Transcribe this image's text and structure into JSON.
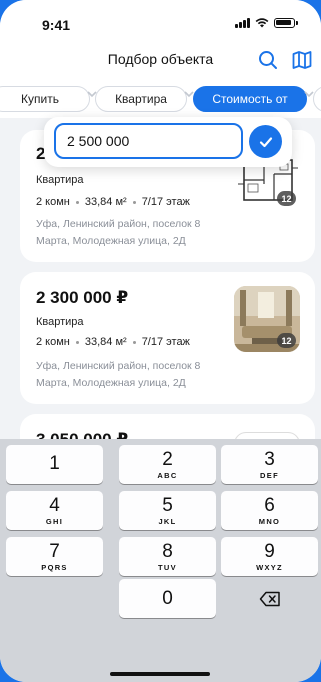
{
  "status": {
    "time": "9:41"
  },
  "header": {
    "title": "Подбор объекта",
    "search_icon": "search-icon",
    "map_icon": "map-icon"
  },
  "filters": [
    "Купить",
    "Квартира",
    "Стоимость от",
    ""
  ],
  "price_popover": {
    "value": "2 500 000",
    "confirm_icon": "checkmark-icon"
  },
  "listings": [
    {
      "price": "2",
      "type": "Квартира",
      "rooms": "2 комн",
      "area": "33,84 м²",
      "floor": "7/17 этаж",
      "address_line1": "Уфа, Ленинский район, поселок 8",
      "address_line2": "Марта, Молодежная улица, 2Д",
      "photo_count": "12",
      "image": "floor-plan"
    },
    {
      "price": "2 300 000 ₽",
      "type": "Квартира",
      "rooms": "2 комн",
      "area": "33,84 м²",
      "floor": "7/17 этаж",
      "address_line1": "Уфа, Ленинский район, поселок 8",
      "address_line2": "Марта, Молодежная улица, 2Д",
      "photo_count": "12",
      "image": "living-room-photo"
    },
    {
      "price": "3 050 000 ₽"
    }
  ],
  "keyboard": {
    "keys": [
      {
        "digit": "1",
        "letters": ""
      },
      {
        "digit": "2",
        "letters": "ABC"
      },
      {
        "digit": "3",
        "letters": "DEF"
      },
      {
        "digit": "4",
        "letters": "GHI"
      },
      {
        "digit": "5",
        "letters": "JKL"
      },
      {
        "digit": "6",
        "letters": "MNO"
      },
      {
        "digit": "7",
        "letters": "PQRS"
      },
      {
        "digit": "8",
        "letters": "TUV"
      },
      {
        "digit": "9",
        "letters": "WXYZ"
      },
      {
        "digit": "0",
        "letters": ""
      }
    ],
    "delete_icon": "backspace-icon"
  },
  "colors": {
    "accent": "#1a73e8",
    "background": "#f1f3f6",
    "keyboard": "#d1d4d9"
  }
}
